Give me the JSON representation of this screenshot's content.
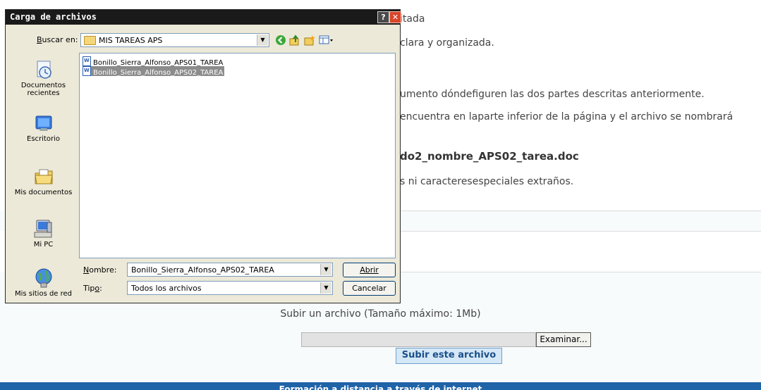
{
  "page": {
    "text_lines": [
      "itada",
      "clara y organizada.",
      "umento dóndefiguren las dos partes descritas anteriormente.",
      "encuentra en laparte inferior de la página y el archivo se nombrará",
      "do2_nombre_APS02_tarea.doc",
      "s ni caracteresespeciales extraños."
    ],
    "upload_caption": "Subir un archivo (Tamaño máximo: 1Mb)",
    "file_input_value": "",
    "browse_button": "Examinar...",
    "upload_button": "Subir este archivo",
    "footer_text": "Formación a distancia a través de internet"
  },
  "dialog": {
    "title": "Carga de archivos",
    "help_button": "?",
    "close_button": "✕",
    "look_in_label_key": "B",
    "look_in_label_rest": "uscar en:",
    "look_in_value": "MIS TAREAS APS",
    "toolbar": {
      "back_icon": "back-icon",
      "up_icon": "up-folder-icon",
      "new_folder_icon": "new-folder-icon",
      "views_icon": "views-menu-icon"
    },
    "places": [
      {
        "label": "Documentos recientes",
        "icon": "recent-documents-icon"
      },
      {
        "label": "Escritorio",
        "icon": "desktop-icon"
      },
      {
        "label": "Mis documentos",
        "icon": "my-documents-icon"
      },
      {
        "label": "Mi PC",
        "icon": "my-computer-icon"
      },
      {
        "label": "Mis sitios de red",
        "icon": "network-places-icon"
      }
    ],
    "files": [
      {
        "name": "Bonillo_Sierra_Alfonso_APS01_TAREA",
        "selected": false
      },
      {
        "name": "Bonillo_Sierra_Alfonso_APS02_TAREA",
        "selected": true
      }
    ],
    "filename_label_key": "N",
    "filename_label_rest": "ombre:",
    "filename_value": "Bonillo_Sierra_Alfonso_APS02_TAREA",
    "filetype_label_rest": "Tip",
    "filetype_label_key": "o",
    "filetype_label_tail": ":",
    "filetype_value": "Todos los archivos",
    "open_button": "Abrir",
    "cancel_button": "Cancelar"
  }
}
